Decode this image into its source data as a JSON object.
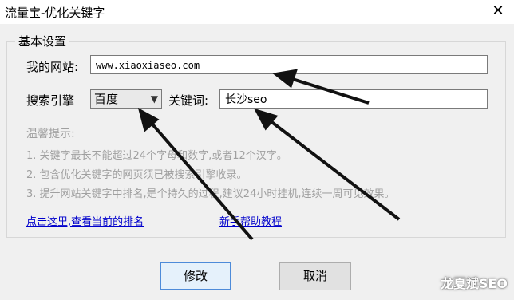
{
  "window": {
    "title": "流量宝-优化关键字",
    "close_glyph": "✕"
  },
  "group": {
    "title": "基本设置"
  },
  "form": {
    "site_label": "我的网站:",
    "site_value": "www.xiaoxiaseo.com",
    "engine_label": "搜索引擎",
    "engine_value": "百度",
    "keyword_label": "关键词:",
    "keyword_value": "长沙seo"
  },
  "tips": {
    "heading": "温馨提示:",
    "items": [
      "1. 关键字最长不能超过24个字母和数字,或者12个汉字。",
      "2. 包含优化关键字的网页须已被搜索引擎收录。",
      "3. 提升网站关键字中排名,是个持久的过程,建议24小时挂机,连续一周可见效果。"
    ]
  },
  "links": {
    "ranking": "点击这里,查看当前的排名",
    "help": "新手帮助教程"
  },
  "buttons": {
    "modify": "修改",
    "cancel": "取消"
  },
  "watermark": "龙夏斌SEO",
  "icons": {
    "dropdown": "chevron-down-icon",
    "close": "close-icon"
  }
}
